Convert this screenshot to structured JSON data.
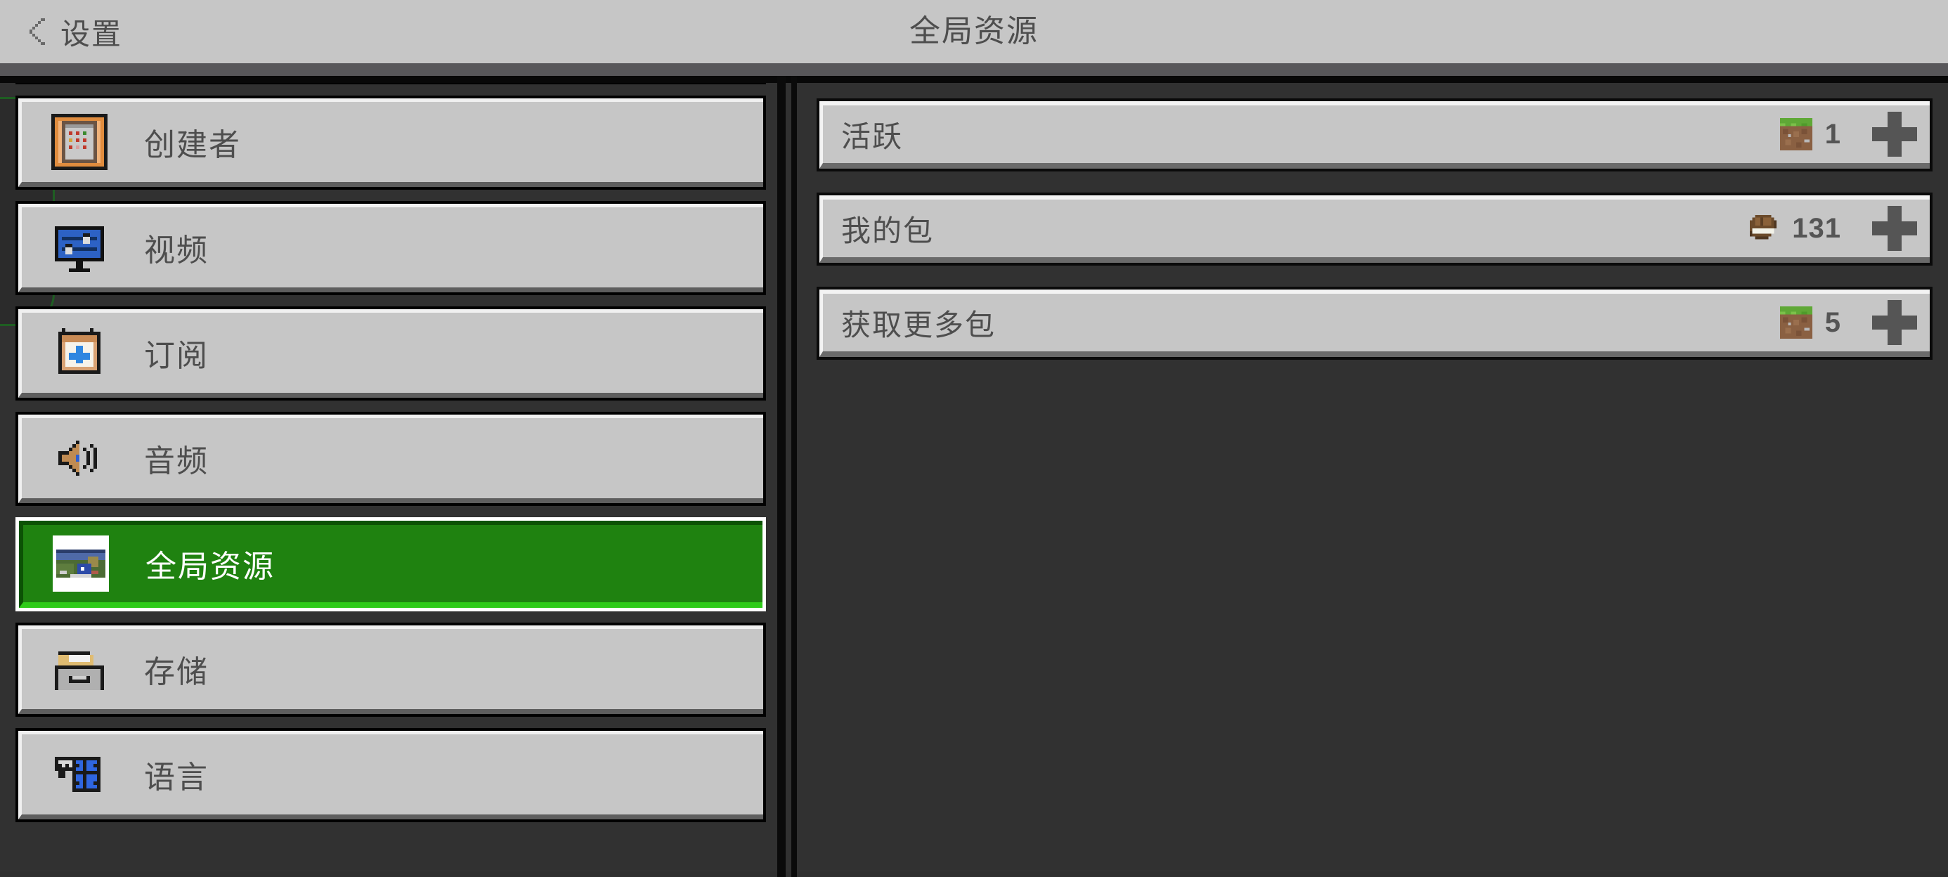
{
  "header": {
    "back_label": "设置",
    "back_icon": "chevron-left-icon",
    "title": "全局资源"
  },
  "sidebar": {
    "items": [
      {
        "label": "创建者",
        "icon": "creator-clipboard-icon",
        "selected": false
      },
      {
        "label": "视频",
        "icon": "video-monitor-icon",
        "selected": false
      },
      {
        "label": "订阅",
        "icon": "subscription-calendar-plus-icon",
        "selected": false
      },
      {
        "label": "音频",
        "icon": "audio-speaker-icon",
        "selected": false
      },
      {
        "label": "全局资源",
        "icon": "global-resources-world-thumbnail-icon",
        "selected": true
      },
      {
        "label": "存储",
        "icon": "storage-file-cabinet-icon",
        "selected": false
      },
      {
        "label": "语言",
        "icon": "language-globe-speech-icon",
        "selected": false
      }
    ]
  },
  "main": {
    "rows": [
      {
        "label": "活跃",
        "count": "1",
        "count_icon": "grass-block-icon",
        "add_icon": "plus-icon"
      },
      {
        "label": "我的包",
        "count": "131",
        "count_icon": "book-pack-icon",
        "add_icon": "plus-icon"
      },
      {
        "label": "获取更多包",
        "count": "5",
        "count_icon": "grass-block-icon",
        "add_icon": "plus-icon"
      }
    ]
  },
  "colors": {
    "selected_green": "#1f8210",
    "selected_green_highlight": "#2ecb18",
    "panel_face": "#c6c6c6",
    "background": "#313131",
    "text": "#4e4e4e",
    "header_bar": "#58575a"
  }
}
